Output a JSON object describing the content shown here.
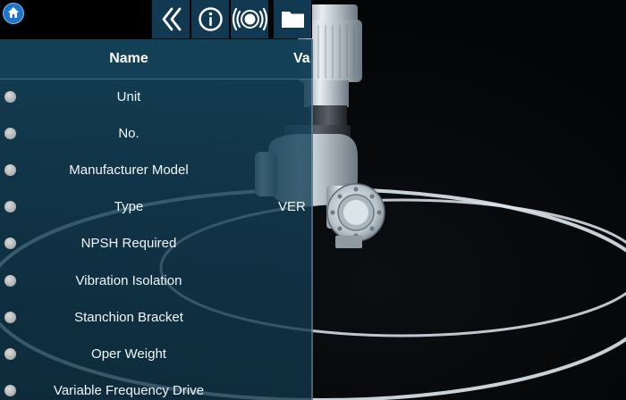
{
  "toolbar": {
    "home_icon": "home-icon",
    "collapse_icon": "double-chevron-left-icon",
    "info_icon": "info-icon",
    "broadcast_icon": "broadcast-icon",
    "folder_icon": "folder-icon"
  },
  "table": {
    "columns": {
      "name": "Name",
      "value": "Va"
    },
    "rows": [
      {
        "name": "Unit",
        "value": ""
      },
      {
        "name": "No.",
        "value": ""
      },
      {
        "name": "Manufacturer Model",
        "value": ""
      },
      {
        "name": "Type",
        "value": "VER"
      },
      {
        "name": "NPSH Required",
        "value": ""
      },
      {
        "name": "Vibration Isolation",
        "value": ""
      },
      {
        "name": "Stanchion Bracket",
        "value": ""
      },
      {
        "name": "Oper Weight",
        "value": ""
      },
      {
        "name": "Variable Frequency Drive",
        "value": ""
      }
    ]
  },
  "colors": {
    "panel": "#16465e",
    "toolbar_button": "#113a52",
    "home_button": "#1f76c9",
    "text": "#ffffff"
  }
}
